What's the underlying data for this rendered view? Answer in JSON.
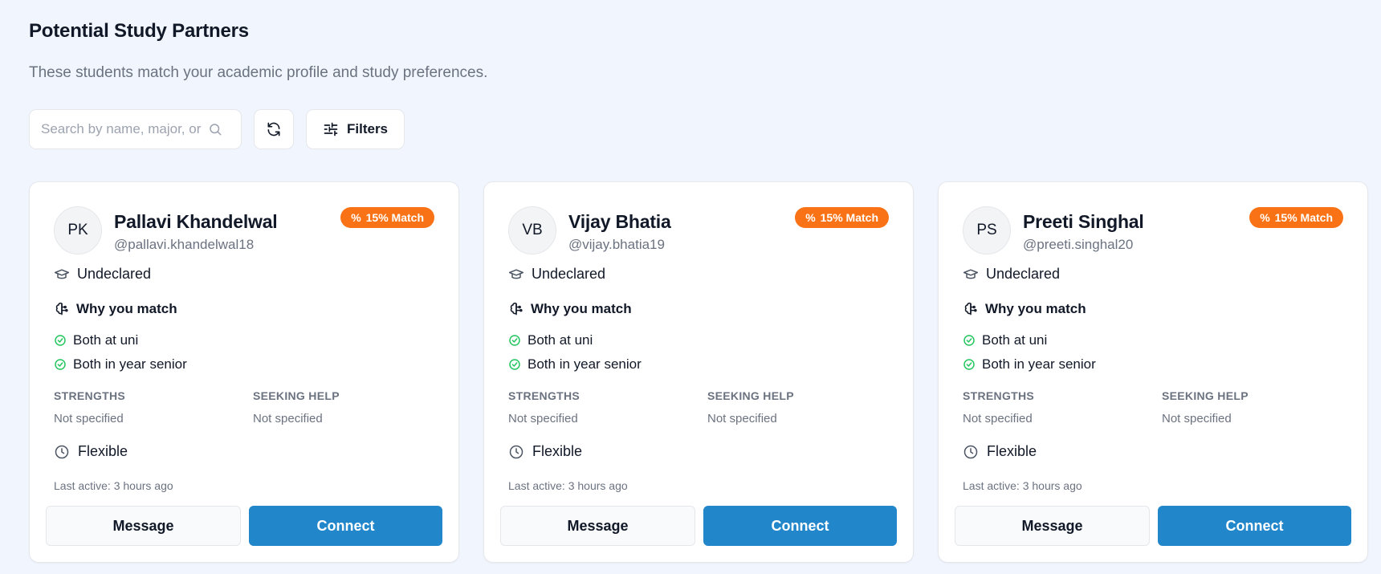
{
  "page": {
    "title": "Potential Study Partners",
    "subtitle": "These students match your academic profile and study preferences."
  },
  "toolbar": {
    "search_placeholder": "Search by name, major, or",
    "refresh_icon": "refresh-icon",
    "filters_label": "Filters",
    "filters_icon": "sliders-icon"
  },
  "labels": {
    "why_you_match": "Why you match",
    "strengths": "STRENGTHS",
    "seeking_help": "SEEKING HELP",
    "message": "Message",
    "connect": "Connect"
  },
  "colors": {
    "accent": "#2286cb",
    "match_badge": "#f97316",
    "check": "#22c55e"
  },
  "cards": [
    {
      "initials": "PK",
      "name": "Pallavi Khandelwal",
      "handle": "@pallavi.khandelwal18",
      "match": "15% Match",
      "major": "Undeclared",
      "reasons": [
        "Both at uni",
        "Both in year senior"
      ],
      "strengths": "Not specified",
      "seeking_help": "Not specified",
      "availability": "Flexible",
      "last_active": "Last active: 3 hours ago"
    },
    {
      "initials": "VB",
      "name": "Vijay Bhatia",
      "handle": "@vijay.bhatia19",
      "match": "15% Match",
      "major": "Undeclared",
      "reasons": [
        "Both at uni",
        "Both in year senior"
      ],
      "strengths": "Not specified",
      "seeking_help": "Not specified",
      "availability": "Flexible",
      "last_active": "Last active: 3 hours ago"
    },
    {
      "initials": "PS",
      "name": "Preeti Singhal",
      "handle": "@preeti.singhal20",
      "match": "15% Match",
      "major": "Undeclared",
      "reasons": [
        "Both at uni",
        "Both in year senior"
      ],
      "strengths": "Not specified",
      "seeking_help": "Not specified",
      "availability": "Flexible",
      "last_active": "Last active: 3 hours ago"
    }
  ]
}
